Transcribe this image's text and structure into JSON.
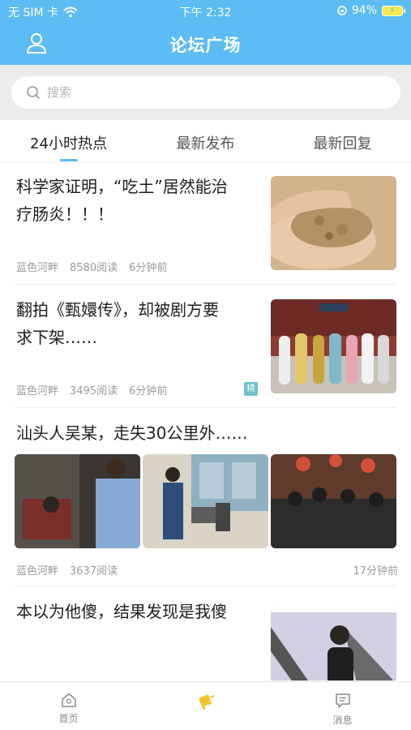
{
  "status_bar": {
    "carrier": "无 SIM 卡",
    "time": "下午 2:32",
    "battery": "94%"
  },
  "nav": {
    "title": "论坛广场",
    "icons": {
      "left": "user-icon"
    }
  },
  "search": {
    "placeholder": "搜索"
  },
  "tabs": [
    {
      "label": "24小时热点",
      "active": true
    },
    {
      "label": "最新发布",
      "active": false
    },
    {
      "label": "最新回复",
      "active": false
    }
  ],
  "posts": [
    {
      "title_line1": "科学家证明，“吃土”居然能治",
      "title_line2": "疗肠炎！！！",
      "author": "蓝色河畔",
      "reads": "8580阅读",
      "time": "6分钟前"
    },
    {
      "title_line1": "翻拍《甄嬛传》，却被剧方要",
      "title_line2": "求下架……",
      "author": "蓝色河畔",
      "reads": "3495阅读",
      "time": "6分钟前",
      "badge": "精"
    },
    {
      "title_line1": "汕头人吴某，走失30公里外……",
      "author": "蓝色河畔",
      "reads": "3637阅读",
      "time": "17分钟前"
    },
    {
      "title_line1": "本以为他傻，结果发现是我傻"
    }
  ],
  "bottom_nav": [
    {
      "label": "首页",
      "icon": "home-icon"
    },
    {
      "label": "",
      "icon": "megaphone-icon"
    },
    {
      "label": "消息",
      "icon": "message-icon"
    }
  ],
  "colors": {
    "primary": "#5cbcf3",
    "badge": "#6ec2c9",
    "accent": "#f2c42c"
  }
}
